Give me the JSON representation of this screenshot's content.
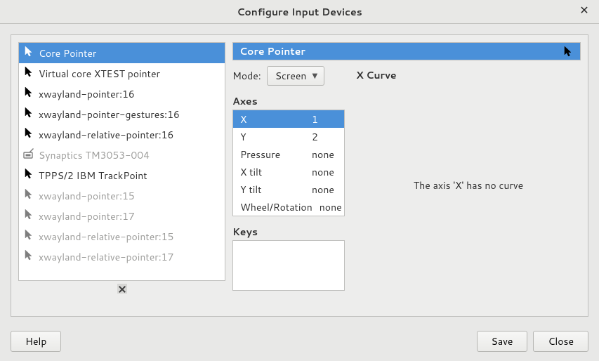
{
  "window": {
    "title": "Configure Input Devices"
  },
  "devices": [
    {
      "label": "Core Pointer",
      "icon": "pointer",
      "selected": true
    },
    {
      "label": "Virtual core XTEST pointer",
      "icon": "pointer"
    },
    {
      "label": "xwayland-pointer:16",
      "icon": "pointer"
    },
    {
      "label": "xwayland-pointer-gestures:16",
      "icon": "pointer"
    },
    {
      "label": "xwayland-relative-pointer:16",
      "icon": "pointer"
    },
    {
      "label": "Synaptics TM3053-004",
      "icon": "tablet",
      "disabled": true
    },
    {
      "label": "TPPS/2 IBM TrackPoint",
      "icon": "pointer"
    },
    {
      "label": "xwayland-pointer:15",
      "icon": "pointer",
      "disabled": true
    },
    {
      "label": "xwayland-pointer:17",
      "icon": "pointer",
      "disabled": true
    },
    {
      "label": "xwayland-relative-pointer:15",
      "icon": "pointer",
      "disabled": true
    },
    {
      "label": "xwayland-relative-pointer:17",
      "icon": "pointer",
      "disabled": true
    }
  ],
  "panel": {
    "title": "Core Pointer",
    "mode_label": "Mode:",
    "mode_value": "Screen",
    "axes_heading": "Axes",
    "axes": [
      {
        "name": "X",
        "value": "1",
        "selected": true
      },
      {
        "name": "Y",
        "value": "2"
      },
      {
        "name": "Pressure",
        "value": "none"
      },
      {
        "name": "X tilt",
        "value": "none"
      },
      {
        "name": "Y tilt",
        "value": "none"
      },
      {
        "name": "Wheel/Rotation",
        "value": "none"
      }
    ],
    "keys_heading": "Keys",
    "curve_heading": "X Curve",
    "curve_message": "The axis 'X' has no curve"
  },
  "buttons": {
    "help": "Help",
    "save": "Save",
    "close": "Close"
  }
}
